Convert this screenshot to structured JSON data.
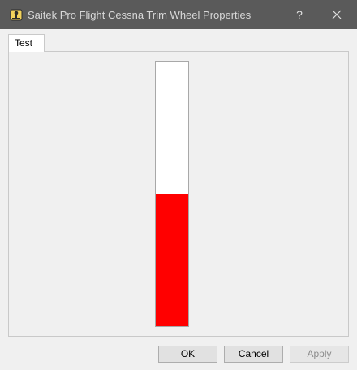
{
  "window": {
    "title": "Saitek Pro Flight Cessna Trim Wheel Properties",
    "app_icon": "joystick-icon",
    "help_label": "?",
    "close_icon": "close-icon"
  },
  "tabs": [
    {
      "label": "Test",
      "selected": true
    }
  ],
  "trim_gauge": {
    "level_fraction": 0.5,
    "fill_color": "#ff0000",
    "empty_color": "#ffffff"
  },
  "buttons": {
    "ok": "OK",
    "cancel": "Cancel",
    "apply": "Apply",
    "apply_disabled": true
  },
  "colors": {
    "titlebar": "#5a5a5a",
    "window_bg": "#f0f0f0"
  }
}
